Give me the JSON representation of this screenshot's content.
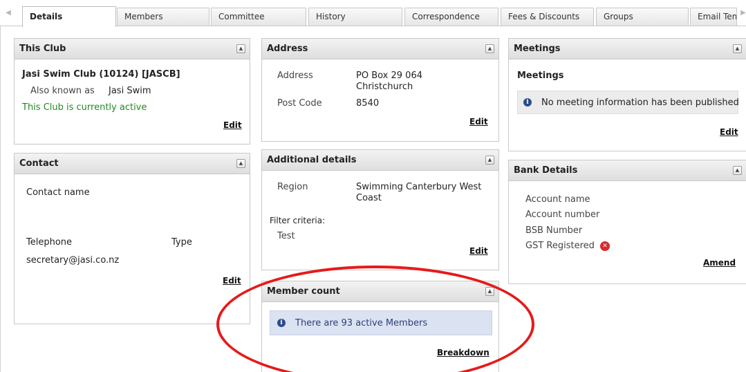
{
  "tabs": [
    {
      "label": "Details",
      "active": true
    },
    {
      "label": "Members"
    },
    {
      "label": "Committee"
    },
    {
      "label": "History"
    },
    {
      "label": "Correspondence"
    },
    {
      "label": "Fees & Discounts"
    },
    {
      "label": "Groups"
    },
    {
      "label": "Email Tem"
    }
  ],
  "this_club": {
    "title": "This Club",
    "name": "Jasi Swim Club (10124) [JASCB]",
    "aka_label": "Also known as",
    "aka_value": "Jasi Swim",
    "status": "This Club is currently active",
    "edit": "Edit"
  },
  "contact": {
    "title": "Contact",
    "name_label": "Contact name",
    "telephone_label": "Telephone",
    "type_label": "Type",
    "email": "secretary@jasi.co.nz",
    "edit": "Edit"
  },
  "address": {
    "title": "Address",
    "address_label": "Address",
    "address_line1": "PO Box 29 064",
    "address_line2": "Christchurch",
    "postcode_label": "Post Code",
    "postcode_value": "8540",
    "edit": "Edit"
  },
  "additional": {
    "title": "Additional details",
    "region_label": "Region",
    "region_line1": "Swimming Canterbury West",
    "region_line2": "Coast",
    "filter_label": "Filter criteria:",
    "filter_value": "Test",
    "edit": "Edit"
  },
  "member_count": {
    "title": "Member count",
    "message": "There are 93 active Members",
    "breakdown": "Breakdown"
  },
  "meetings": {
    "title": "Meetings",
    "subtitle": "Meetings",
    "message": "No meeting information has been published",
    "edit": "Edit"
  },
  "bank": {
    "title": "Bank Details",
    "account_name_label": "Account name",
    "account_number_label": "Account number",
    "bsb_label": "BSB Number",
    "gst_label": "GST Registered",
    "amend": "Amend"
  },
  "colors": {
    "active_status": "#1f8a1f",
    "info_bg": "#dbe3f2",
    "highlight_ellipse": "#e61a1a",
    "gst_icon": "#d62b2b"
  }
}
